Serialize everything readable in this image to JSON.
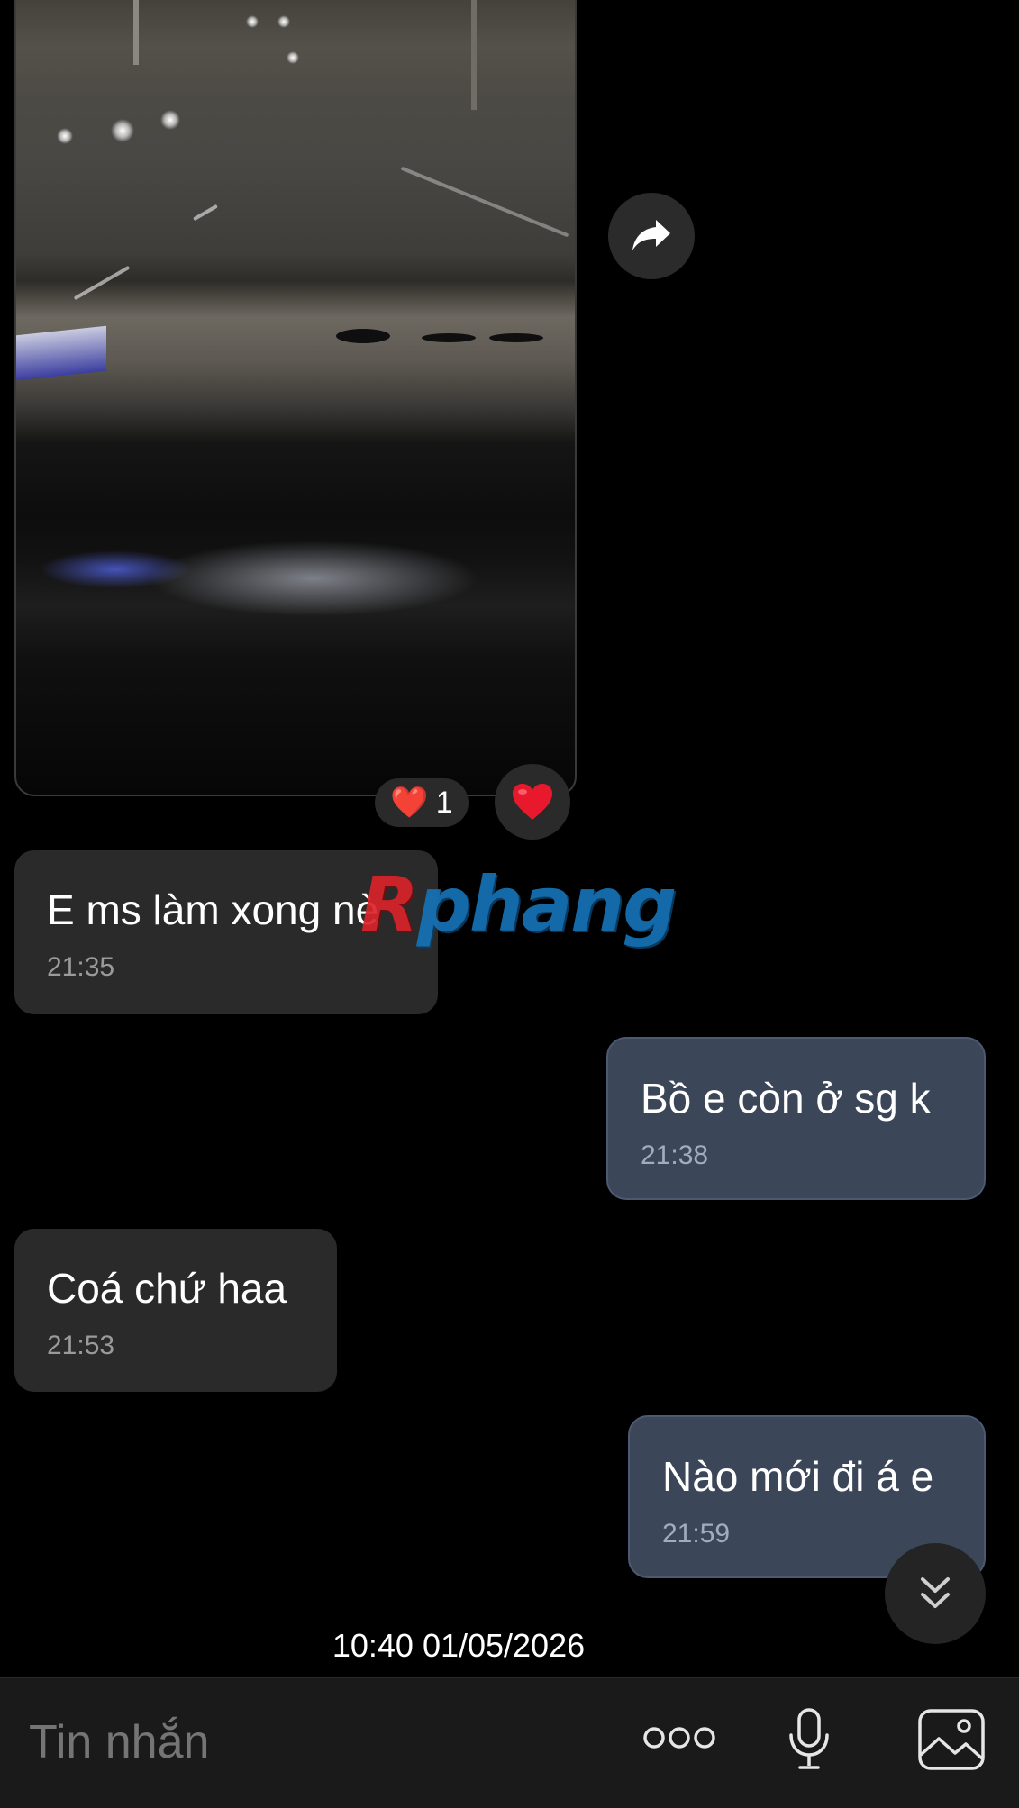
{
  "media_message": {
    "reaction_emoji": "❤️",
    "reaction_count": "1",
    "quick_reaction_emoji": "❤️"
  },
  "messages": [
    {
      "direction": "incoming",
      "text": "E ms làm xong nè",
      "time": "21:35"
    },
    {
      "direction": "outgoing",
      "text": "Bồ e còn ở sg k",
      "time": "21:38"
    },
    {
      "direction": "incoming",
      "text": "Coá chứ haa",
      "time": "21:53"
    },
    {
      "direction": "outgoing",
      "text": "Nào mới đi á e",
      "time": "21:59"
    }
  ],
  "date_stamp": "10:40 01/05/2026",
  "watermark": {
    "prefix": "R",
    "text": "phang"
  },
  "composer": {
    "placeholder": "Tin nhắn"
  },
  "icons": {
    "forward": "forward-arrow-icon",
    "scroll_down": "double-chevron-down-icon",
    "more": "more-dots-icon",
    "mic": "microphone-icon",
    "gallery": "image-gallery-icon"
  },
  "colors": {
    "background": "#000000",
    "incoming_bubble": "#2a2a2a",
    "outgoing_bubble": "#3b4658",
    "timestamp": "#9a9a9a",
    "input_bar": "#1a1a1a"
  }
}
